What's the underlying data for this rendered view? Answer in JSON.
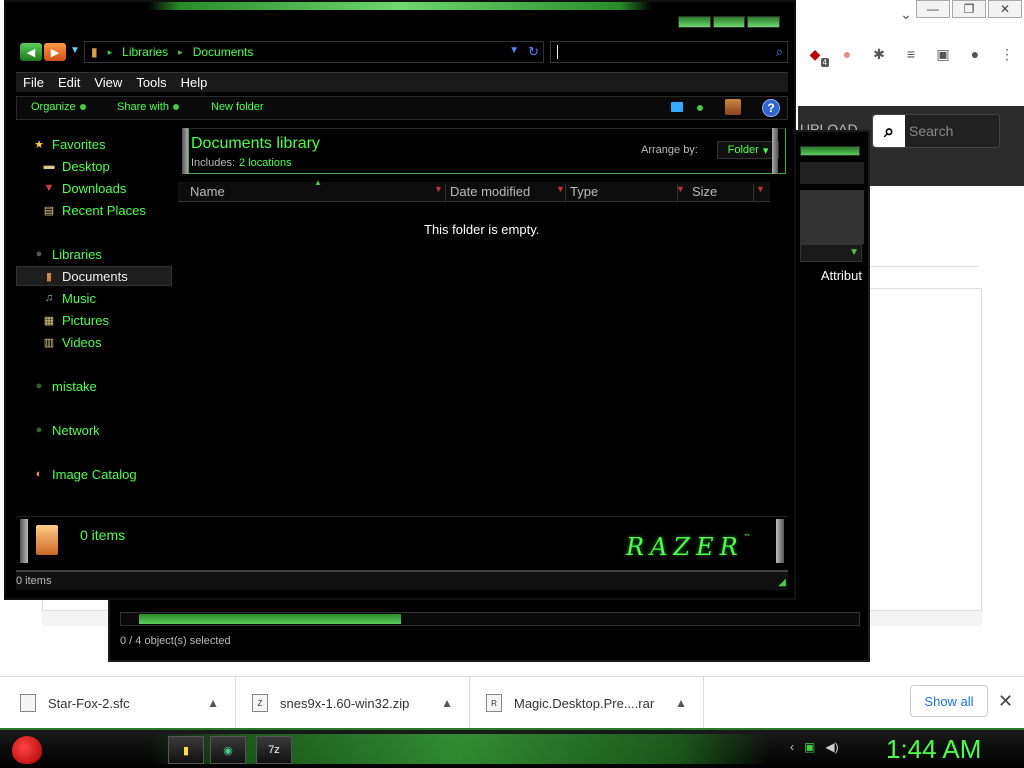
{
  "browser": {
    "window_controls": [
      "—",
      "❐",
      "✕"
    ],
    "toolbar_icons": [
      "extension-ublock",
      "extension-flag",
      "puzzle",
      "media",
      "sidebar",
      "profile",
      "menu"
    ],
    "ext_badge": "4",
    "site": {
      "upload": "UPLOAD",
      "search_placeholder": "Search"
    }
  },
  "explorer_back": {
    "column_label": "Attribut",
    "status": "0 / 4 object(s) selected"
  },
  "explorer": {
    "address": {
      "crumbs": [
        "Libraries",
        "Documents"
      ]
    },
    "menu": [
      "File",
      "Edit",
      "View",
      "Tools",
      "Help"
    ],
    "commands": {
      "organize": "Organize",
      "share_with": "Share with",
      "new_folder": "New folder"
    },
    "nav": {
      "favorites": "Favorites",
      "desktop": "Desktop",
      "downloads": "Downloads",
      "recent": "Recent Places",
      "libraries": "Libraries",
      "documents": "Documents",
      "music": "Music",
      "pictures": "Pictures",
      "videos": "Videos",
      "mistake": "mistake",
      "network": "Network",
      "image_catalog": "Image Catalog"
    },
    "library": {
      "title": "Documents library",
      "includes_label": "Includes:",
      "includes_link": "2 locations",
      "arrange_label": "Arrange by:",
      "arrange_value": "Folder"
    },
    "columns": [
      "Name",
      "Date modified",
      "Type",
      "Size"
    ],
    "empty_message": "This folder is empty.",
    "details_count": "0 items",
    "brand": "RAZER",
    "brand_tm": "™",
    "status": "0 items"
  },
  "downloads": {
    "items": [
      {
        "name": "Star-Fox-2.sfc"
      },
      {
        "name": "snes9x-1.60-win32.zip"
      },
      {
        "name": "Magic.Desktop.Pre....rar"
      }
    ],
    "show_all": "Show all"
  },
  "taskbar": {
    "tasks": [
      "explorer",
      "chrome",
      "7z"
    ],
    "task_7z_label": "7z",
    "clock": "1:44 AM"
  },
  "colors": {
    "accent_green": "#4cff4c",
    "chrome_blue": "#1a73e8"
  }
}
